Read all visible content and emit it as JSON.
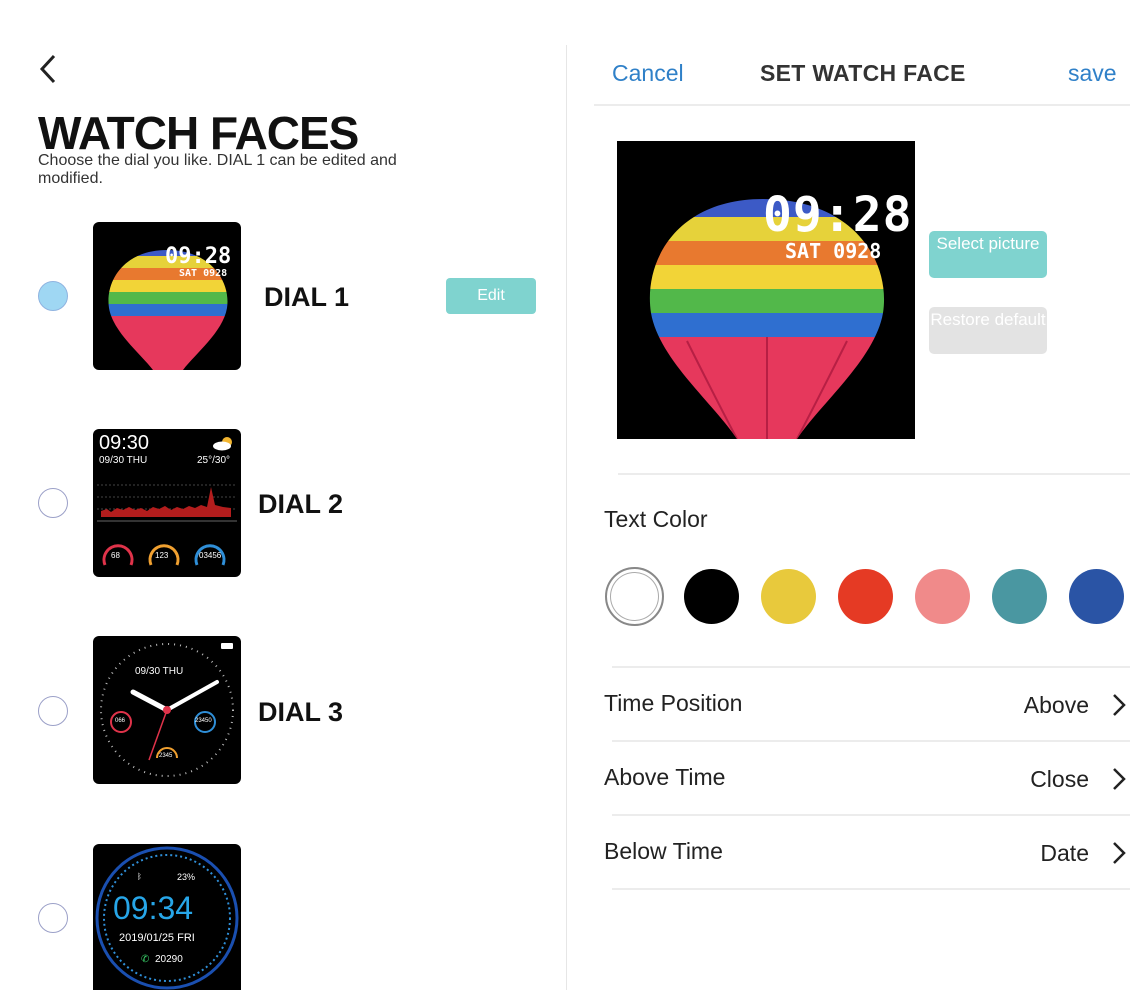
{
  "left": {
    "title": "WATCH FACES",
    "subtitle": "Choose the dial you like. DIAL 1 can be edited and modified.",
    "dials": [
      {
        "label": "DIAL 1",
        "selected": true,
        "time": "09:28",
        "date": "SAT 0928"
      },
      {
        "label": "DIAL 2",
        "selected": false,
        "time": "09:30",
        "date": "09/30 THU",
        "temp": "25°/30°",
        "stats": [
          "68",
          "123",
          "03456"
        ]
      },
      {
        "label": "DIAL 3",
        "selected": false,
        "date": "09/30 THU",
        "stats": [
          "066",
          "23450",
          "2345"
        ]
      },
      {
        "label": "",
        "selected": false,
        "time": "09:34",
        "battery": "23%",
        "date": "2019/01/25  FRI",
        "steps": "20290"
      }
    ],
    "edit_label": "Edit"
  },
  "right": {
    "header": {
      "cancel": "Cancel",
      "title": "SET WATCH FACE",
      "save": "save"
    },
    "preview": {
      "time": "09:28",
      "date": "SAT 0928"
    },
    "select_picture": "Select picture",
    "restore_default": "Restore default",
    "text_color_label": "Text Color",
    "colors": [
      "#ffffff",
      "#000000",
      "#e8c93c",
      "#e53a24",
      "#f08a8a",
      "#4a97a1",
      "#2a54a5"
    ],
    "settings": [
      {
        "label": "Time Position",
        "value": "Above"
      },
      {
        "label": "Above Time",
        "value": "Close"
      },
      {
        "label": "Below Time",
        "value": "Date"
      }
    ]
  },
  "icons": [
    "back-chevron-icon",
    "chevron-right-icon",
    "weather-cloud-icon",
    "heart-icon",
    "flame-icon",
    "footsteps-icon",
    "battery-icon",
    "bluetooth-icon",
    "phone-icon"
  ]
}
